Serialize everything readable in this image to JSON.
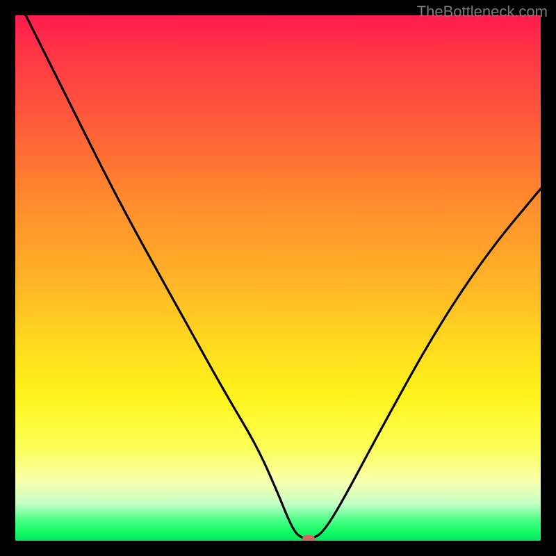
{
  "watermark": "TheBottleneck.com",
  "chart_data": {
    "type": "line",
    "title": "",
    "xlabel": "",
    "ylabel": "",
    "xlim": [
      0,
      100
    ],
    "ylim": [
      0,
      100
    ],
    "grid": false,
    "series": [
      {
        "name": "curve",
        "x": [
          2,
          10,
          20,
          30,
          40,
          46,
          50,
          52,
          53.5,
          55,
          56.5,
          58.5,
          62,
          70,
          80,
          90,
          100
        ],
        "y": [
          100,
          84,
          64,
          46,
          28,
          18,
          9,
          4,
          1.2,
          0.4,
          0.4,
          1.5,
          7,
          22,
          40,
          55,
          67
        ]
      }
    ],
    "marker": {
      "x": 55.8,
      "y": 0.2
    },
    "colors": {
      "curve": "#000000",
      "marker": "#d36a61",
      "gradient_top": "#ff1a4d",
      "gradient_mid": "#ffd81f",
      "gradient_bottom": "#00e65c"
    }
  }
}
